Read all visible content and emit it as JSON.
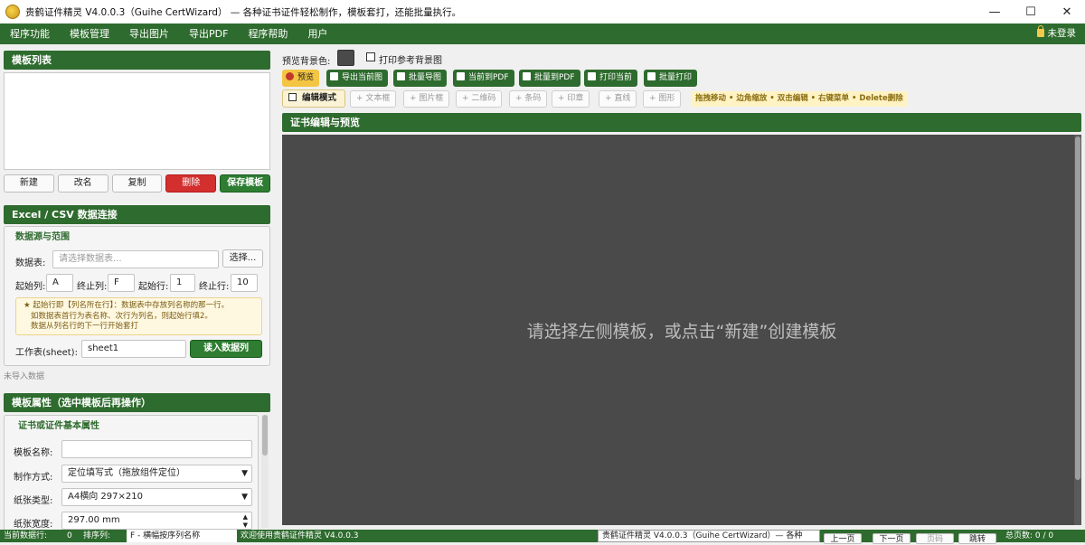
{
  "window": {
    "title": "贵鹤证件精灵 V4.0.0.3（Guihe CertWizard） — 各种证书证件轻松制作，模板套打，还能批量执行。",
    "controls": {
      "minimize": "—",
      "maximize": "☐",
      "close": "✕"
    }
  },
  "menu": {
    "items": [
      "程序功能",
      "模板管理",
      "导出图片",
      "导出PDF",
      "程序帮助",
      "用户"
    ],
    "login": "未登录"
  },
  "templates": {
    "header": "模板列表",
    "buttons": {
      "new": "新建",
      "rename": "改名",
      "copy": "复制",
      "delete": "删除",
      "save": "保存模板"
    }
  },
  "excel": {
    "header": "Excel / CSV 数据连接",
    "group": "数据源与范围",
    "datafile_label": "数据表:",
    "datafile_placeholder": "请选择数据表...",
    "browse": "选择...",
    "startcol_label": "起始列:",
    "startcol": "A",
    "endcol_label": "终止列:",
    "endcol": "F",
    "startrow_label": "起始行:",
    "startrow": "1",
    "endrow_label": "终止行:",
    "endrow": "10",
    "note1": "★ 起始行即【列名所在行】：数据表中存放列名称的那一行。",
    "note2": "如数据表首行为表名称、次行为列名，则起始行填2。",
    "note3": "数据从列名行的下一行开始套打",
    "sheet_label": "工作表(sheet):",
    "sheet": "sheet1",
    "read_button": "读入数据列",
    "status": "未导入数据"
  },
  "props": {
    "header": "模板属性（选中模板后再操作）",
    "group": "证书或证件基本属性",
    "name_label": "模板名称:",
    "name_value": "",
    "method_label": "制作方式:",
    "method_value": "定位填写式（拖放组件定位）",
    "paper_label": "纸张类型:",
    "paper_value": "A4横向 297×210",
    "width_label": "纸张宽度:",
    "width_value": "297.00 mm"
  },
  "preview": {
    "bg_label": "预览背景色:",
    "bg_color": "#4a4a4a",
    "print_bg_label": "打印参考背景图"
  },
  "toolbar": {
    "preview": "预览",
    "export_current": "导出当前图",
    "batch_image": "批量导图",
    "current_pdf": "当前到PDF",
    "batch_pdf": "批量到PDF",
    "print_current": "打印当前",
    "batch_print": "批量打印"
  },
  "edit": {
    "mode": "编辑模式",
    "text": "+ 文本框",
    "image": "+ 图片框",
    "qrcode": "+ 二维码",
    "barcode": "+ 条码",
    "stamp": "+ 印章",
    "line": "+ 直线",
    "shape": "+ 图形",
    "hint": "拖拽移动 • 边角缩放 • 双击编辑 • 右键菜单 • Delete删除"
  },
  "canvas": {
    "header": "证书编辑与预览",
    "empty_message": "请选择左侧模板，或点击“新建”创建模板"
  },
  "statusbar": {
    "seg1": "当前数据行:",
    "seg1b": "0",
    "seg2": "排序列:",
    "sort_value": "F - 横幅按序列名称",
    "seg3": "欢迎使用贵鹤证件精灵 V4.0.0.3",
    "tooltip": "贵鹤证件精灵 V4.0.0.3（Guihe CertWizard）— 各种",
    "prev": "上一页",
    "next": "下一页",
    "page": "页码",
    "jump": "跳转",
    "total": "总页数: 0 / 0"
  }
}
